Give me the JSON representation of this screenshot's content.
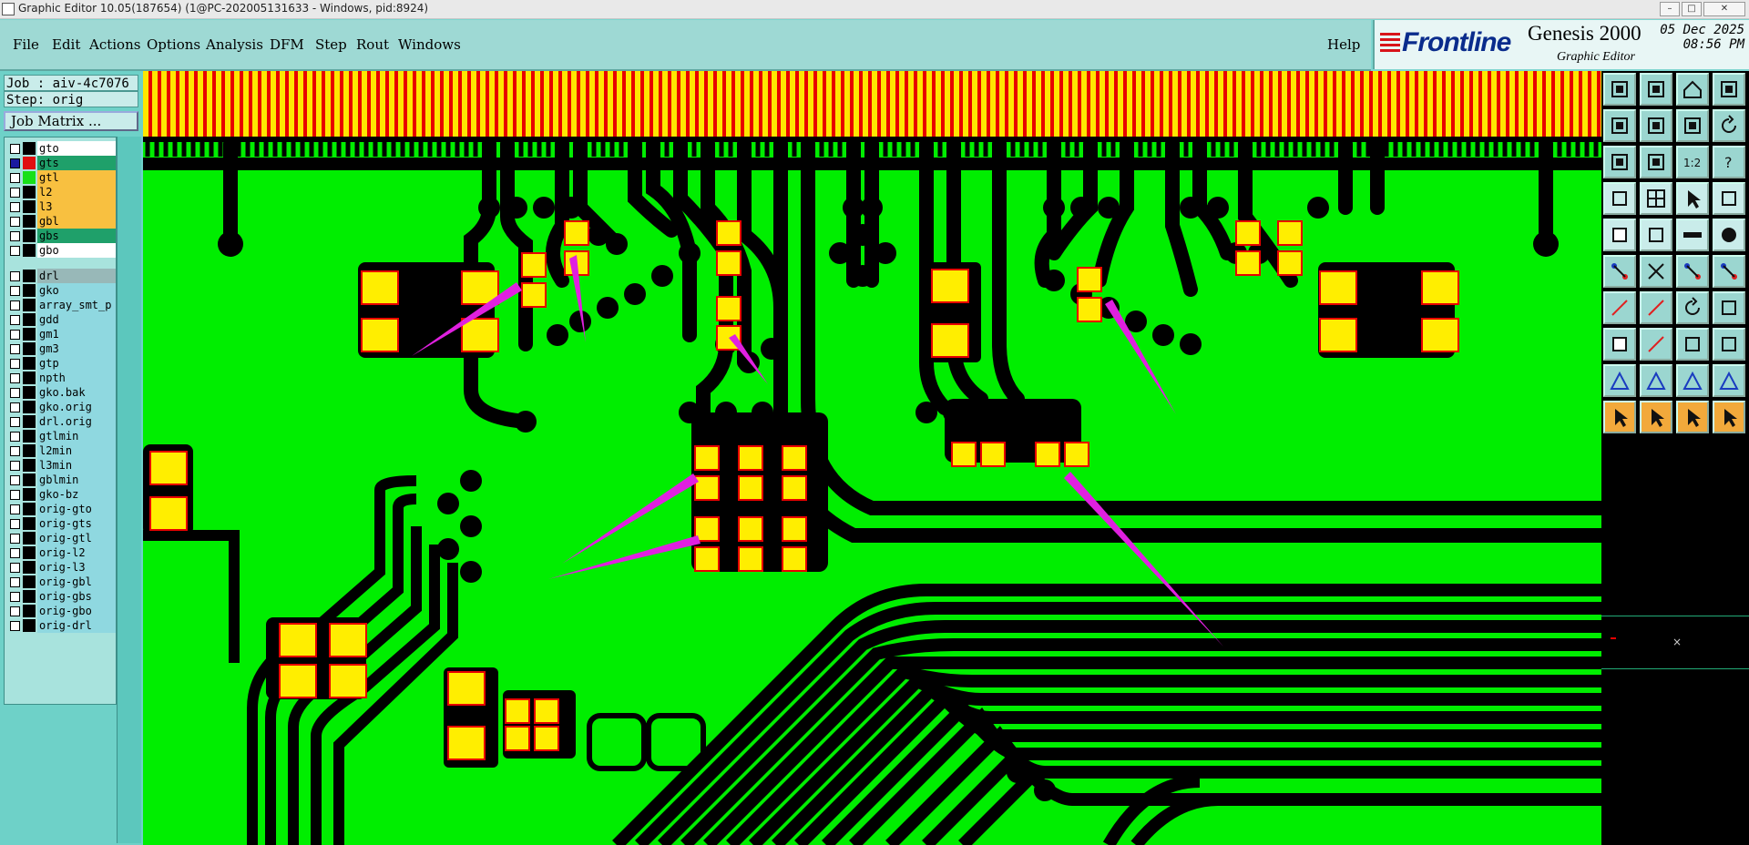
{
  "window": {
    "title": "Graphic Editor 10.05(187654) (1@PC-202005131633 - Windows, pid:8924)"
  },
  "menu": {
    "items": [
      "File",
      "Edit",
      "Actions",
      "Options",
      "Analysis",
      "DFM",
      "Step",
      "Rout",
      "Windows"
    ],
    "help": "Help"
  },
  "brand": {
    "logo": "Frontline",
    "product": "Genesis 2000",
    "subtitle": "Graphic Editor",
    "date": "05 Dec 2025",
    "time": "08:56 PM"
  },
  "job": {
    "job_label": "Job : aiv-4c7076",
    "step_label": "Step: orig",
    "matrix_button": "Job Matrix ..."
  },
  "layers": [
    {
      "name": "gto",
      "bg": "#ffffff",
      "swatch": "#000000",
      "checked": false
    },
    {
      "name": "gts",
      "bg": "#1fa06a",
      "swatch": "#e01010",
      "checked": true
    },
    {
      "name": "gtl",
      "bg": "#f8c040",
      "swatch": "#18e018",
      "checked": false
    },
    {
      "name": "l2",
      "bg": "#f8c040",
      "swatch": "#000000",
      "checked": false
    },
    {
      "name": "l3",
      "bg": "#f8c040",
      "swatch": "#000000",
      "checked": false
    },
    {
      "name": "gbl",
      "bg": "#f8c040",
      "swatch": "#000000",
      "checked": false
    },
    {
      "name": "gbs",
      "bg": "#1fa06a",
      "swatch": "#000000",
      "checked": false
    },
    {
      "name": "gbo",
      "bg": "#ffffff",
      "swatch": "#000000",
      "checked": false
    },
    {
      "name": "drl",
      "bg": "#98b8b8",
      "swatch": "#000000",
      "checked": false
    },
    {
      "name": "gko",
      "bg": "#8fd8e0",
      "swatch": "#000000",
      "checked": false
    },
    {
      "name": "array_smt_p",
      "bg": "#8fd8e0",
      "swatch": "#000000",
      "checked": false
    },
    {
      "name": "gdd",
      "bg": "#8fd8e0",
      "swatch": "#000000",
      "checked": false
    },
    {
      "name": "gm1",
      "bg": "#8fd8e0",
      "swatch": "#000000",
      "checked": false
    },
    {
      "name": "gm3",
      "bg": "#8fd8e0",
      "swatch": "#000000",
      "checked": false
    },
    {
      "name": "gtp",
      "bg": "#8fd8e0",
      "swatch": "#000000",
      "checked": false
    },
    {
      "name": "npth",
      "bg": "#8fd8e0",
      "swatch": "#000000",
      "checked": false
    },
    {
      "name": "gko.bak",
      "bg": "#8fd8e0",
      "swatch": "#000000",
      "checked": false
    },
    {
      "name": "gko.orig",
      "bg": "#8fd8e0",
      "swatch": "#000000",
      "checked": false
    },
    {
      "name": "drl.orig",
      "bg": "#8fd8e0",
      "swatch": "#000000",
      "checked": false
    },
    {
      "name": "gtlmin",
      "bg": "#8fd8e0",
      "swatch": "#000000",
      "checked": false
    },
    {
      "name": "l2min",
      "bg": "#8fd8e0",
      "swatch": "#000000",
      "checked": false
    },
    {
      "name": "l3min",
      "bg": "#8fd8e0",
      "swatch": "#000000",
      "checked": false
    },
    {
      "name": "gblmin",
      "bg": "#8fd8e0",
      "swatch": "#000000",
      "checked": false
    },
    {
      "name": "gko-bz",
      "bg": "#8fd8e0",
      "swatch": "#000000",
      "checked": false
    },
    {
      "name": "orig-gto",
      "bg": "#8fd8e0",
      "swatch": "#000000",
      "checked": false
    },
    {
      "name": "orig-gts",
      "bg": "#8fd8e0",
      "swatch": "#000000",
      "checked": false
    },
    {
      "name": "orig-gtl",
      "bg": "#8fd8e0",
      "swatch": "#000000",
      "checked": false
    },
    {
      "name": "orig-l2",
      "bg": "#8fd8e0",
      "swatch": "#000000",
      "checked": false
    },
    {
      "name": "orig-l3",
      "bg": "#8fd8e0",
      "swatch": "#000000",
      "checked": false
    },
    {
      "name": "orig-gbl",
      "bg": "#8fd8e0",
      "swatch": "#000000",
      "checked": false
    },
    {
      "name": "orig-gbs",
      "bg": "#8fd8e0",
      "swatch": "#000000",
      "checked": false
    },
    {
      "name": "orig-gbo",
      "bg": "#8fd8e0",
      "swatch": "#000000",
      "checked": false
    },
    {
      "name": "orig-drl",
      "bg": "#8fd8e0",
      "swatch": "#000000",
      "checked": false
    }
  ],
  "tools": [
    "fit-job-icon",
    "fit-step-icon",
    "home-view-icon",
    "zoom-window-icon",
    "pan-left-icon",
    "pan-right-icon",
    "zoom-back-icon",
    "redraw-icon",
    "zoom-in-icon",
    "zoom-out-icon",
    "scale-1-2-icon",
    "query-icon",
    "snap-icon",
    "grid-icon",
    "layer-select-icon",
    "feature-filter-icon",
    "pad-icon",
    "shape-icon",
    "measure-icon",
    "drill-icon",
    "node-icon",
    "cross-icon",
    "line-point-icon",
    "arc-point-icon",
    "line-edit-icon",
    "slash-icon",
    "rotate-icon",
    "align-icon",
    "add-pad-icon",
    "trace-icon",
    "connect-icon",
    "copy-icon",
    "poly-icon",
    "outline-icon",
    "bridge-icon",
    "arch-icon",
    "select-icon",
    "select-box-icon",
    "select-touch-icon",
    "select-net-icon"
  ],
  "colors": {
    "copper": "#00ee00",
    "pad": "#ffee00",
    "pad_outline": "#e80000",
    "arrow": "#e020e0",
    "panel": "#6ed1c8"
  }
}
